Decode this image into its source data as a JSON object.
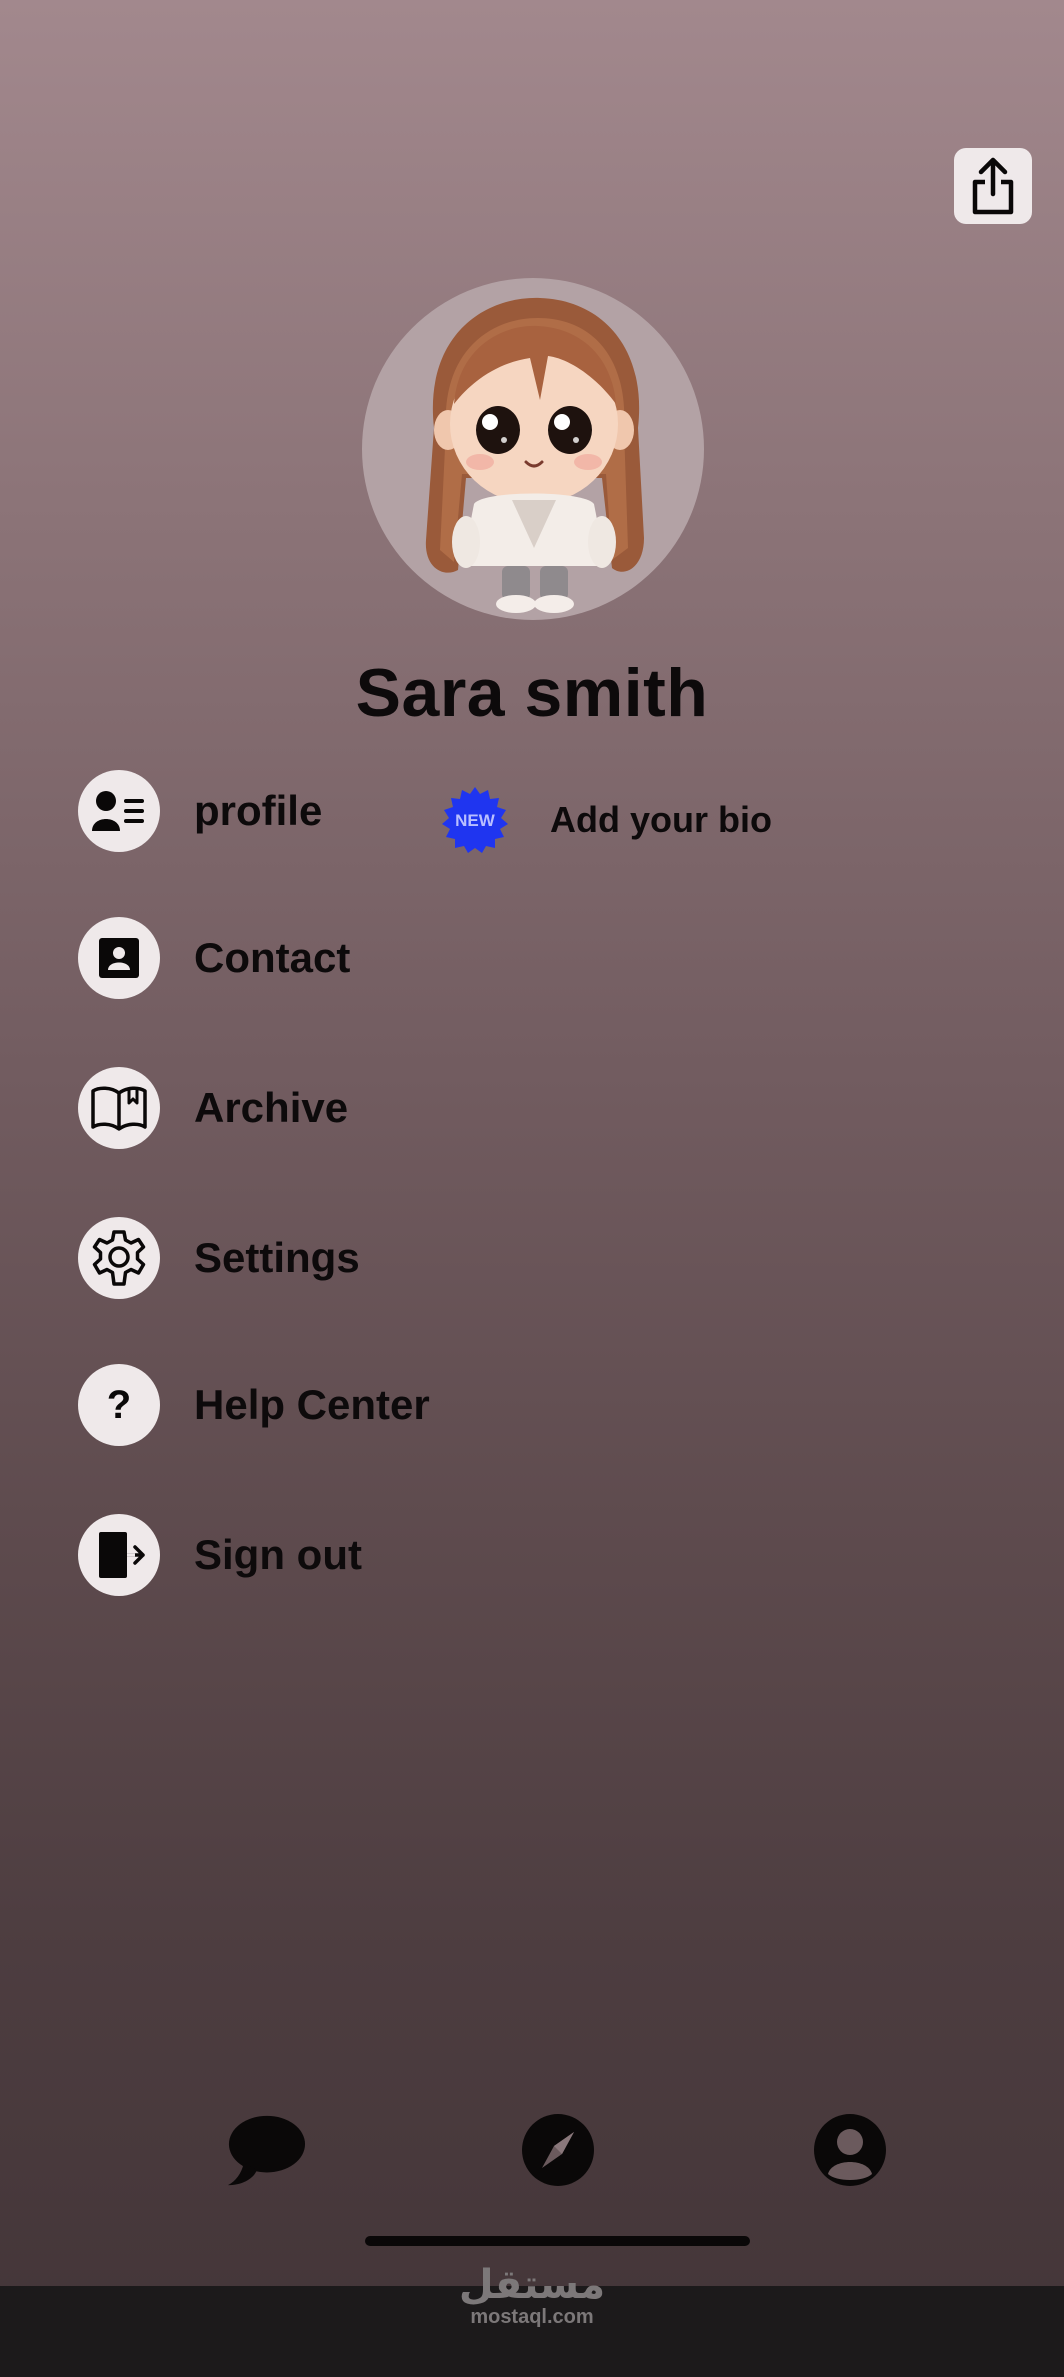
{
  "header": {
    "share_icon": "share-icon"
  },
  "profile": {
    "name": "Sara smith",
    "avatar": "cartoon-girl-avatar"
  },
  "bio": {
    "badge": "NEW",
    "label": "Add your bio",
    "badge_color": "#1f35f0"
  },
  "menu": [
    {
      "label": "profile",
      "icon": "profile-card-icon"
    },
    {
      "label": "Contact",
      "icon": "contact-book-icon"
    },
    {
      "label": "Archive",
      "icon": "open-book-icon"
    },
    {
      "label": "Settings",
      "icon": "gear-icon"
    },
    {
      "label": "Help Center",
      "icon": "question-icon"
    },
    {
      "label": "Sign out",
      "icon": "sign-out-icon"
    }
  ],
  "tabbar": {
    "items": [
      "chat-bubble-icon",
      "compass-icon",
      "user-avatar-icon"
    ]
  },
  "watermark": {
    "arabic": "مستقل",
    "latin": "mostaql.com"
  }
}
